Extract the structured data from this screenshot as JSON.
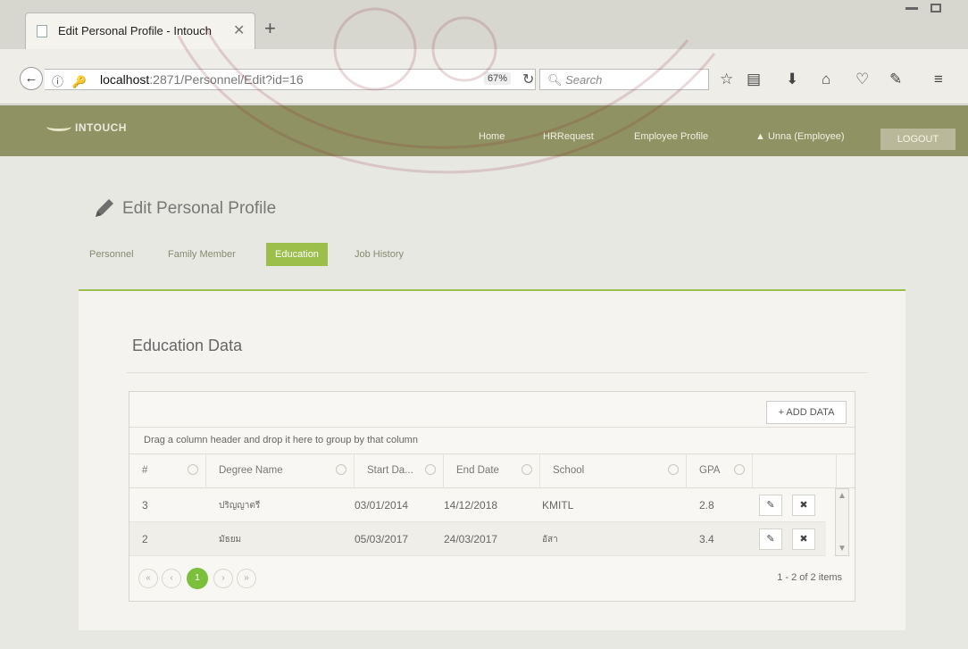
{
  "browser": {
    "tab_title": "Edit Personal Profile - Intouch",
    "url_host": "localhost",
    "url_path": ":2871/Personnel/Edit?id=16",
    "zoom": "67%",
    "search_placeholder": "Search"
  },
  "app": {
    "logo": "INTOUCH",
    "nav": {
      "home": "Home",
      "hr_request": "HRRequest",
      "employee_profile": "Employee Profile",
      "user": "▲ Unna (Employee)",
      "logout": "LOGOUT"
    }
  },
  "page": {
    "title": "Edit Personal Profile",
    "tabs": [
      "Personnel",
      "Family Member",
      "Education",
      "Job History"
    ],
    "active_tab": "Education"
  },
  "education": {
    "section_title": "Education Data",
    "add_button": "+ ADD DATA",
    "group_hint": "Drag a column header and drop it here to group by that column",
    "columns": [
      "#",
      "Degree Name",
      "Start Da...",
      "End Date",
      "School",
      "GPA"
    ],
    "rows": [
      {
        "no": "3",
        "degree": "ปริญญาตรี",
        "start": "03/01/2014",
        "end": "14/12/2018",
        "school": "KMITL",
        "gpa": "2.8"
      },
      {
        "no": "2",
        "degree": "มัธยม",
        "start": "05/03/2017",
        "end": "24/03/2017",
        "school": "อัสา",
        "gpa": "3.4"
      }
    ],
    "pager": {
      "first": "«",
      "prev": "‹",
      "current": "1",
      "next": "›",
      "last": "»",
      "info": "1 - 2 of 2 items"
    }
  },
  "colors": {
    "accent_green": "#9cbf4c",
    "header_olive": "#8f9262",
    "pager_current": "#7cbf3a"
  }
}
